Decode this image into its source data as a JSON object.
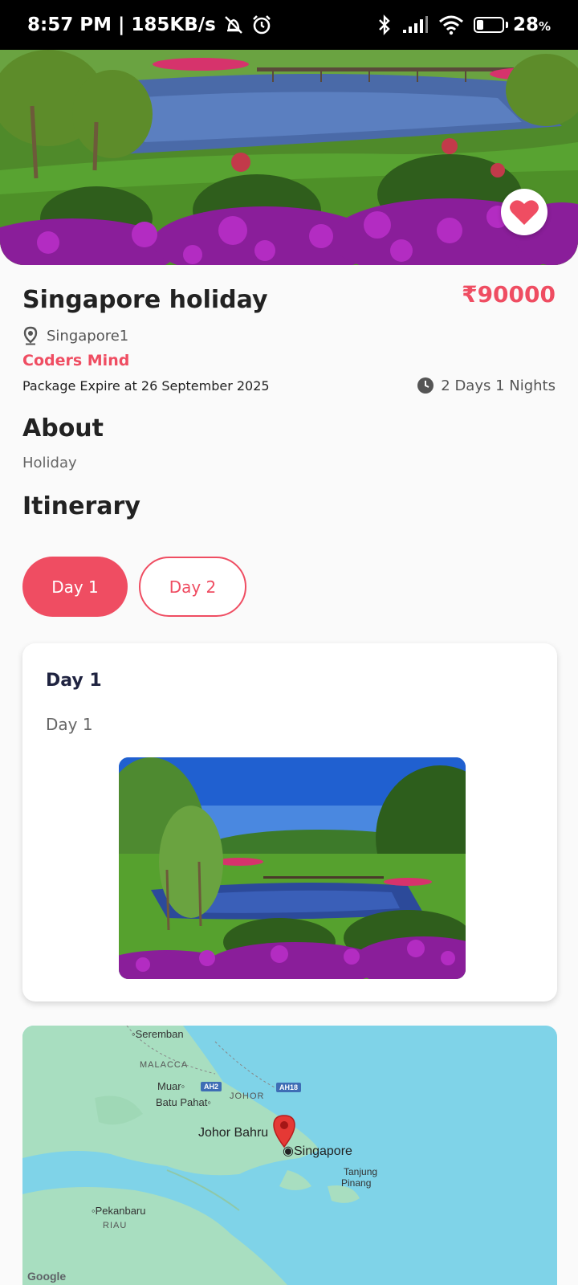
{
  "status_bar": {
    "time_speed": "8:57 PM | 185KB/s",
    "battery_percent": "28",
    "battery_level": 0.28
  },
  "package": {
    "title": "Singapore holiday",
    "price": "₹90000",
    "location": "Singapore1",
    "company": "Coders Mind",
    "expiry": "Package Expire at 26 September 2025",
    "duration": "2 Days 1 Nights",
    "favorited": true
  },
  "about": {
    "heading": "About",
    "text": "Holiday"
  },
  "itinerary": {
    "heading": "Itinerary",
    "tabs": [
      {
        "label": "Day 1",
        "active": true
      },
      {
        "label": "Day 2",
        "active": false
      }
    ],
    "card": {
      "title": "Day 1",
      "description": "Day 1"
    }
  },
  "map": {
    "labels": {
      "seremban": "Seremban",
      "malacca": "MALACCA",
      "muar": "Muar",
      "batu_pahat": "Batu Pahat",
      "johor": "JOHOR",
      "johor_bahru": "Johor Bahru",
      "singapore": "Singapore",
      "tanjung_pinang_1": "Tanjung",
      "tanjung_pinang_2": "Pinang",
      "pekanbaru": "Pekanbaru",
      "riau": "RIAU",
      "google": "Google"
    },
    "roads": {
      "ah2": "AH2",
      "ah18": "AH18"
    }
  },
  "colors": {
    "accent": "#ef4d62",
    "sea": "#7fd3e8",
    "land": "#a8dec0"
  }
}
